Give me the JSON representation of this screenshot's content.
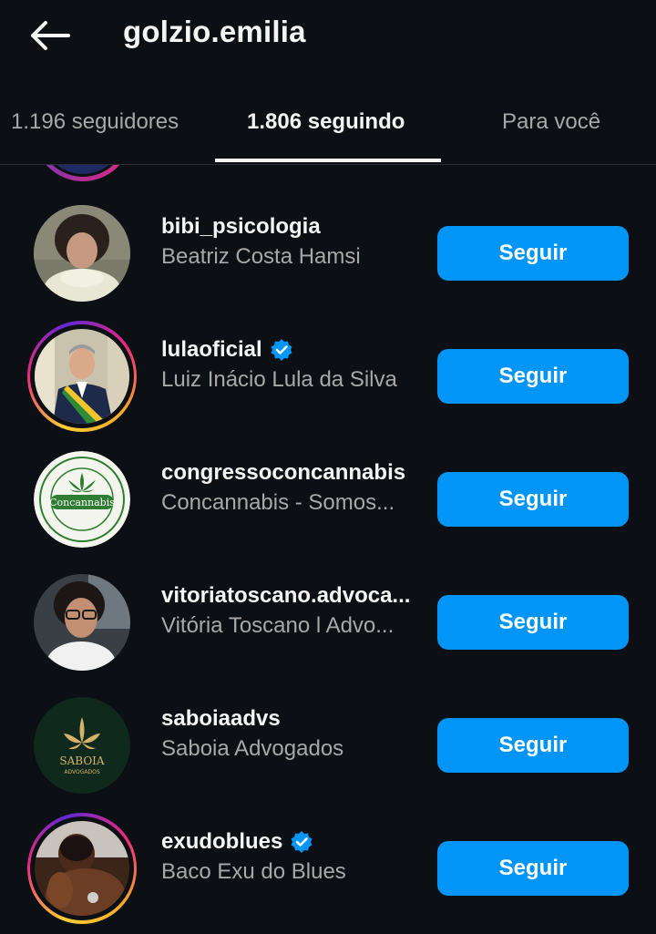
{
  "header": {
    "back_icon": "arrow-left-icon",
    "username": "golzio.emilia"
  },
  "tabs": [
    {
      "label": "1.196 seguidores",
      "active": false
    },
    {
      "label": "1.806 seguindo",
      "active": true
    },
    {
      "label": "Para você",
      "active": false
    }
  ],
  "colors": {
    "background": "#0c0f14",
    "button": "#0095f6",
    "primary_text": "#f5f5f5",
    "secondary_text": "#a8a8a8",
    "verified": "#0095f6"
  },
  "accounts": [
    {
      "handle": "bibi_psicologia",
      "name": "Beatriz Costa Hamsi",
      "verified": false,
      "story_ring": false,
      "button": "Seguir"
    },
    {
      "handle": "lulaoficial",
      "name": "Luiz Inácio Lula da Silva",
      "verified": true,
      "story_ring": true,
      "button": "Seguir"
    },
    {
      "handle": "congressoconcannabis",
      "name": "Concannabis - Somos...",
      "verified": false,
      "story_ring": false,
      "button": "Seguir",
      "logo_text": "Concannabis"
    },
    {
      "handle": "vitoriatoscano.advoca...",
      "name": "Vitória Toscano l Advo...",
      "verified": false,
      "story_ring": false,
      "button": "Seguir"
    },
    {
      "handle": "saboiaadvs",
      "name": "Saboia Advogados",
      "verified": false,
      "story_ring": false,
      "button": "Seguir",
      "logo_text": "SABOIA",
      "logo_subtext": "ADVOGADOS"
    },
    {
      "handle": "exudoblues",
      "name": "Baco Exu do Blues",
      "verified": true,
      "story_ring": true,
      "button": "Seguir"
    }
  ]
}
